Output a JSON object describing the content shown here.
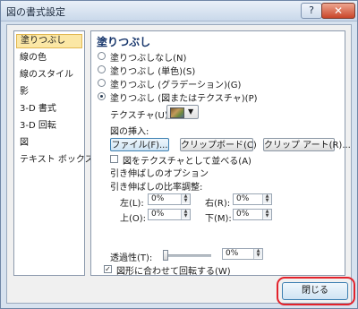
{
  "window": {
    "title": "図の書式設定",
    "help": "?",
    "close": "✕"
  },
  "sidebar": {
    "items": [
      {
        "label": "塗りつぶし",
        "selected": true
      },
      {
        "label": "線の色"
      },
      {
        "label": "線のスタイル"
      },
      {
        "label": "影"
      },
      {
        "label": "3-D 書式"
      },
      {
        "label": "3-D 回転"
      },
      {
        "label": "図"
      },
      {
        "label": "テキスト ボックス"
      }
    ]
  },
  "fill": {
    "heading": "塗りつぶし",
    "options": [
      {
        "label": "塗りつぶしなし(N)",
        "checked": false
      },
      {
        "label": "塗りつぶし (単色)(S)",
        "checked": false
      },
      {
        "label": "塗りつぶし (グラデーション)(G)",
        "checked": false
      },
      {
        "label": "塗りつぶし (図またはテクスチャ)(P)",
        "checked": true
      }
    ],
    "texture_label": "テクスチャ(U):",
    "insert_from_label": "図の挿入:",
    "file_button": "ファイル(F)...",
    "clipboard_button": "クリップボード(C)",
    "clipart_button": "クリップ アート(R)...",
    "tile_checkbox": "図をテクスチャとして並べる(A)",
    "tile_checked": false,
    "stretch_options_label": "引き伸ばしのオプション",
    "offset_label": "引き伸ばしの比率調整:",
    "offsets": {
      "left_label": "左(L):",
      "left_value": "0%",
      "right_label": "右(R):",
      "right_value": "0%",
      "top_label": "上(O):",
      "top_value": "0%",
      "bottom_label": "下(M):",
      "bottom_value": "0%"
    },
    "transparency_label": "透過性(T):",
    "transparency_value": "0%",
    "transparency_level": 0,
    "rotate_checkbox": "図形に合わせて回転する(W)",
    "rotate_checked": true
  },
  "footer": {
    "close_button": "閉じる"
  },
  "colors": {
    "annotation": "#e3222b",
    "heading": "#16356b",
    "selected_bg": "#fbe7a5"
  }
}
